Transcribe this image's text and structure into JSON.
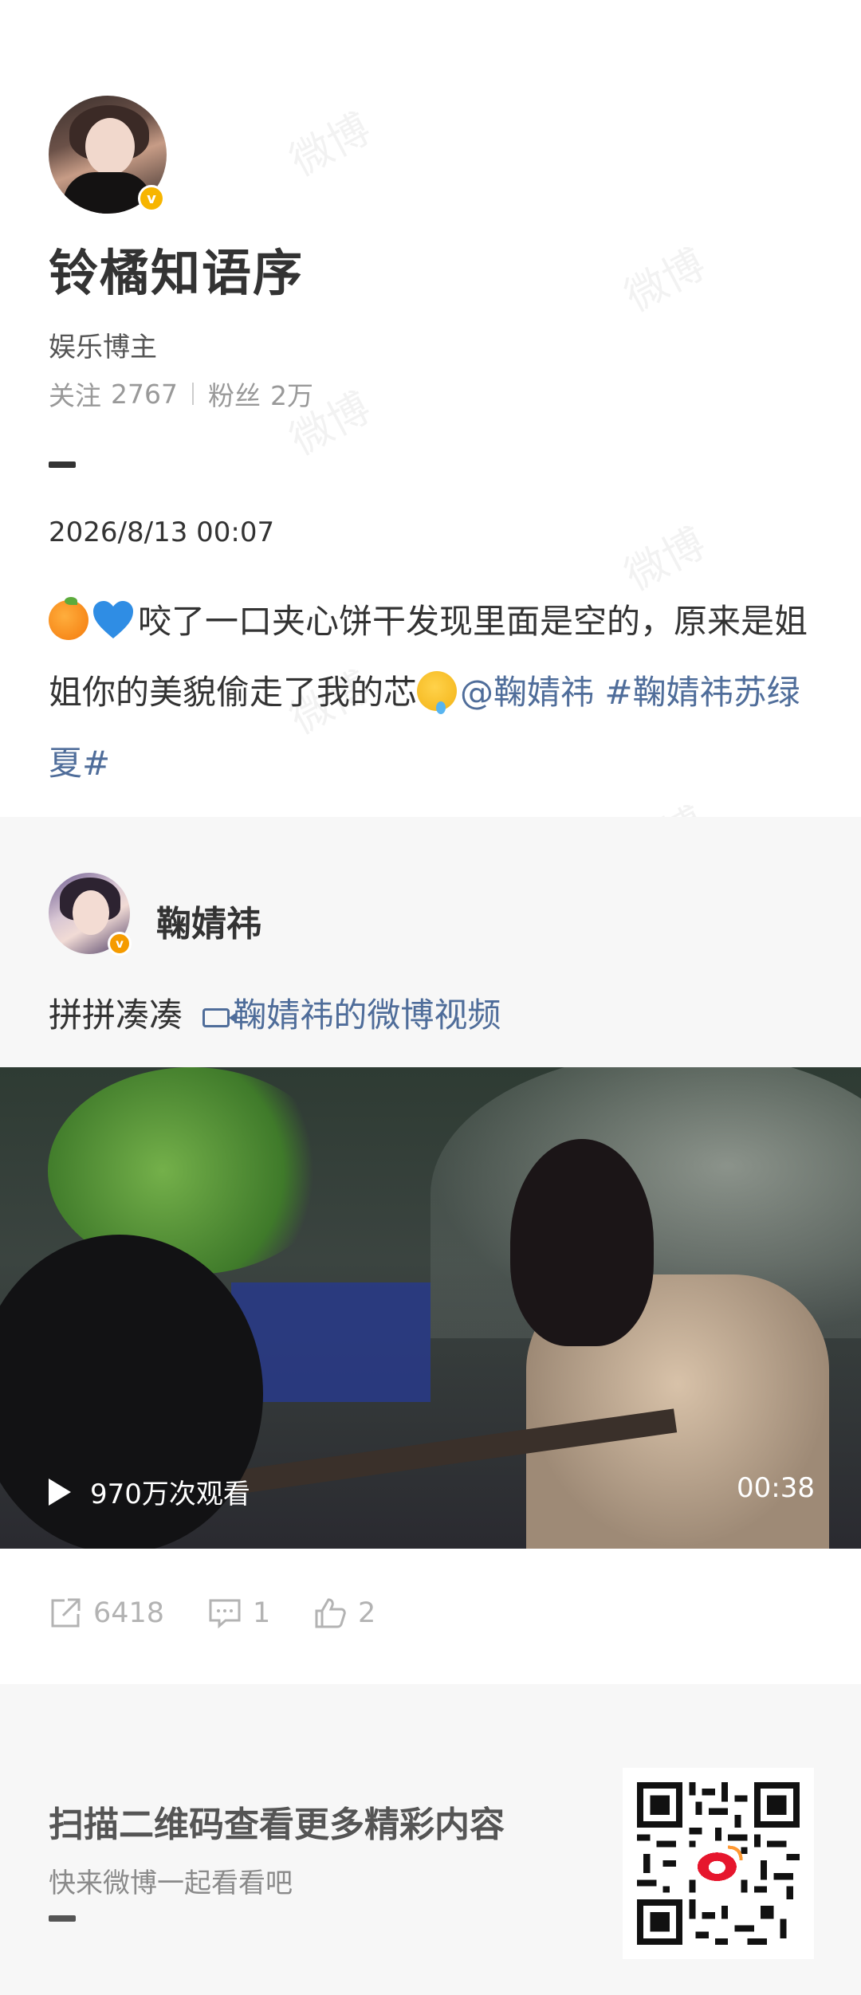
{
  "profile": {
    "username": "铃橘知语序",
    "bio": "娱乐博主",
    "following_label": "关注",
    "following_count": "2767",
    "followers_label": "粉丝",
    "followers_count": "2万"
  },
  "post": {
    "date": "2026/8/13 00:07",
    "text_main": "咬了一口夹心饼干发现里面是空的，原来是姐姐你的美貌偷走了我的芯",
    "mention": "@鞠婧祎",
    "hashtag": " #鞠婧祎苏绿夏#"
  },
  "repost": {
    "author": "鞠婧祎",
    "text": "拼拼凑凑",
    "video_link": "鞠婧祎的微博视频",
    "views": "970万次观看",
    "duration": "00:38"
  },
  "actions": {
    "reposts": "6418",
    "comments": "1",
    "likes": "2"
  },
  "footer": {
    "title": "扫描二维码查看更多精彩内容",
    "subtitle": "快来微博一起看看吧"
  },
  "watermark": "微博",
  "colors": {
    "link": "#4f6d9a",
    "verified_badge": "#f7b500",
    "muted": "#999999"
  }
}
